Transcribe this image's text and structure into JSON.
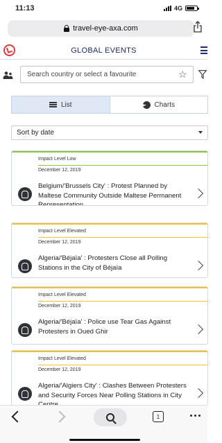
{
  "status_bar": {
    "time": "11:13",
    "network": "4G"
  },
  "browser": {
    "url": "travel-eye-axa.com",
    "tab_count": "1"
  },
  "app": {
    "title": "GLOBAL EVENTS"
  },
  "search": {
    "placeholder": "Search country or select a favourite"
  },
  "view_toggle": {
    "list_label": "List",
    "charts_label": "Charts",
    "active": "List"
  },
  "sort": {
    "label": "Sort by date"
  },
  "colors": {
    "low": "#8cc63f",
    "elevated": "#f2c12e",
    "brand_red": "#e23b3b",
    "nav_blue": "#1d2a6b"
  },
  "events": [
    {
      "level": "Impact Level Low",
      "severity": "low",
      "date": "December 12, 2019",
      "title": "Belgium/'Brussels City' : Protest Planned by Maltese Community Outside Maltese Permanent Representation"
    },
    {
      "level": "Impact Level Elevated",
      "severity": "elevated",
      "date": "December 12, 2019",
      "title": "Algeria/'Béjaïa' : Protesters Close all Polling Stations in the City of Béjaïa"
    },
    {
      "level": "Impact Level Elevated",
      "severity": "elevated",
      "date": "December 12, 2019",
      "title": "Algeria/'Béjaïa' : Police use Tear Gas Against Protesters in Oued Ghir"
    },
    {
      "level": "Impact Level Elevated",
      "severity": "elevated",
      "date": "December 12, 2019",
      "title": "Algeria/'Algiers City' : Clashes Between Protesters and Security Forces Near Polling Stations in City Centre"
    }
  ]
}
